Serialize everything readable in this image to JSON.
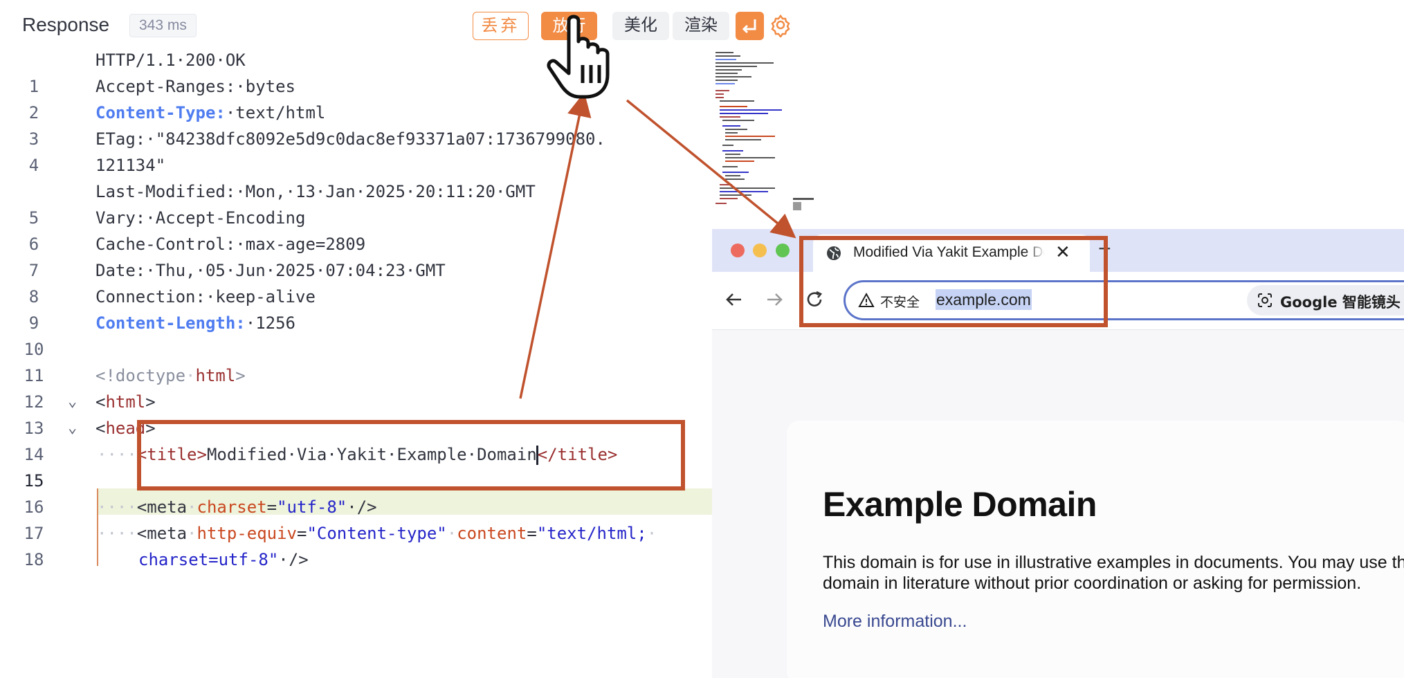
{
  "response": {
    "title": "Response",
    "time": "343 ms",
    "buttons": {
      "discard": "丢弃",
      "release": "放行",
      "beautify": "美化",
      "render": "渲染",
      "wrap_icon": "return-icon",
      "settings_icon": "gear-icon"
    },
    "accent_color": "#f28b44"
  },
  "editor": {
    "lines": [
      {
        "n": "1",
        "text": "HTTP/1.1·200·OK"
      },
      {
        "n": "2",
        "key": "Accept-Ranges:",
        "val": "·bytes"
      },
      {
        "n": "3",
        "key": "Content-Type:",
        "val": "·text/html"
      },
      {
        "n": "4",
        "key": "ETag:",
        "val": "·\"84238dfc8092e5d9c0dac8ef93371a07:1736799080.",
        "cont": "121134\""
      },
      {
        "n": "5",
        "key": "Last-Modified:",
        "val": "·Mon,·13·Jan·2025·20:11:20·GMT"
      },
      {
        "n": "6",
        "key": "Vary:",
        "val": "·Accept-Encoding"
      },
      {
        "n": "7",
        "key": "Cache-Control:",
        "val": "·max-age=2809"
      },
      {
        "n": "8",
        "key": "Date:",
        "val": "·Thu,·05·Jun·2025·07:04:23·GMT"
      },
      {
        "n": "9",
        "key": "Connection:",
        "val": "·keep-alive"
      },
      {
        "n": "10",
        "key": "Content-Length:",
        "val": "·1256"
      },
      {
        "n": "11"
      },
      {
        "n": "12",
        "a": "<!doctype",
        "b": "·",
        "c": "html",
        "d": ">"
      },
      {
        "n": "13",
        "a": "<",
        "b": "html",
        "c": ">"
      },
      {
        "n": "14",
        "a": "<",
        "b": "head",
        "c": ">"
      },
      {
        "n": "15",
        "ws": "····",
        "open": "<title>",
        "text_a": "Modified·Via·Yakit·Example·Domain",
        "close": "</title>"
      },
      {
        "n": "16"
      },
      {
        "n": "17",
        "ws": "····",
        "tag": "<meta",
        "sp": "·",
        "attr": "charset",
        "eq": "=",
        "str": "\"utf-8\"",
        "end": "·/>"
      },
      {
        "n": "18",
        "ws": "····",
        "tag": "<meta",
        "sp": "·",
        "attr": "http-equiv",
        "eq": "=",
        "str": "\"Content-type\"",
        "sp2": "·",
        "attr2": "content",
        "eq2": "=",
        "str2": "\"text/html;",
        "sp3": "·",
        "cont_str": "charset=utf-8\"",
        "cont_end": "·/>"
      }
    ]
  },
  "browser": {
    "tab_title": "Modified Via Yakit Example Domain",
    "tab_close": "✕",
    "new_tab": "+",
    "insecure_label": "不安全",
    "url": "example.com",
    "google_chip": "Google 智能镜头",
    "page": {
      "heading": "Example Domain",
      "para_line1": "This domain is for use in illustrative examples in documents. You may use this",
      "para_line2": "domain in literature without prior coordination or asking for permission.",
      "link": "More information..."
    }
  },
  "annotations": {
    "color": "#c0522d"
  }
}
